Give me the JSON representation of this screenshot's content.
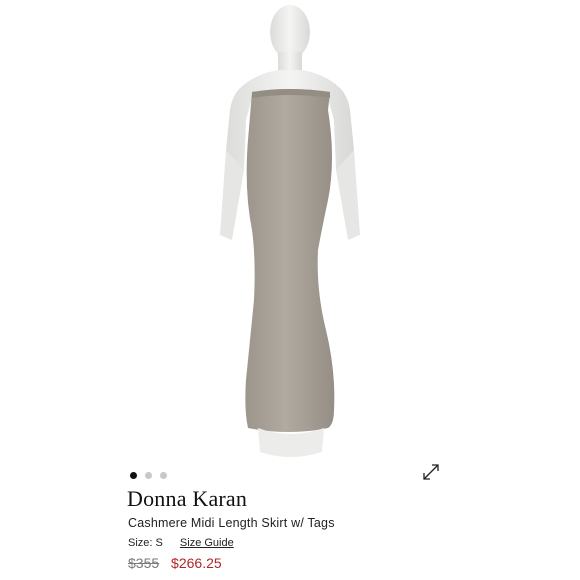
{
  "product": {
    "brand": "Donna Karan",
    "title": "Cashmere Midi Length Skirt w/ Tags",
    "size_label": "Size: S",
    "size_guide_label": "Size Guide",
    "original_price": "$355",
    "sale_price": "$266.25"
  },
  "carousel": {
    "total_images": 3,
    "active_index": 0
  },
  "icons": {
    "expand": "expand-icon"
  },
  "colors": {
    "sale_price": "#b0272a",
    "original_price": "#7a7a7a",
    "dress": "#a7a097",
    "mannequin": "#ececea"
  }
}
